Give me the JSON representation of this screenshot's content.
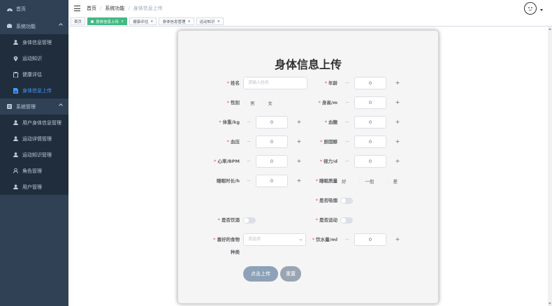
{
  "sidebar": {
    "items": [
      {
        "label": "首页",
        "icon": "dashboard-icon",
        "type": "top"
      },
      {
        "label": "系统功能",
        "icon": "function-icon",
        "type": "group"
      },
      {
        "label": "身体信息管理",
        "icon": "user-icon",
        "type": "sub"
      },
      {
        "label": "运动知识",
        "icon": "location-icon",
        "type": "sub"
      },
      {
        "label": "健康评估",
        "icon": "clipboard-icon",
        "type": "sub"
      },
      {
        "label": "身体信息上传",
        "icon": "document-icon",
        "type": "sub",
        "active": true
      },
      {
        "label": "系统管理",
        "icon": "settings-icon",
        "type": "group"
      },
      {
        "label": "用户身体信息管理",
        "icon": "user-icon",
        "type": "sub"
      },
      {
        "label": "运动详情管理",
        "icon": "user-icon",
        "type": "sub"
      },
      {
        "label": "运动知识管理",
        "icon": "user-icon",
        "type": "sub"
      },
      {
        "label": "角色管理",
        "icon": "person-icon",
        "type": "sub"
      },
      {
        "label": "用户管理",
        "icon": "user-icon",
        "type": "sub"
      }
    ]
  },
  "breadcrumb": [
    "首页",
    "系统功能",
    "身体信息上传"
  ],
  "tags": [
    {
      "label": "首页",
      "closable": false,
      "active": false
    },
    {
      "label": "身体信息上传",
      "closable": true,
      "active": true
    },
    {
      "label": "健康评估",
      "closable": true,
      "active": false
    },
    {
      "label": "身体信息管理",
      "closable": true,
      "active": false
    },
    {
      "label": "运动知识",
      "closable": true,
      "active": false
    }
  ],
  "tag_close": "×",
  "form": {
    "title": "身体信息上传",
    "required_mark": "*",
    "name": {
      "label": "姓名",
      "placeholder": "请输入姓名"
    },
    "age": {
      "label": "年龄",
      "value": "0"
    },
    "gender": {
      "label": "性别",
      "options": [
        "男",
        "女"
      ]
    },
    "height": {
      "label": "身高/m",
      "value": "0"
    },
    "weight": {
      "label": "体重/kg",
      "value": "0"
    },
    "blood_sugar": {
      "label": "血糖",
      "value": "0"
    },
    "blood_pressure": {
      "label": "血压",
      "value": "0"
    },
    "cholesterol": {
      "label": "胆固醇",
      "value": "0"
    },
    "heart_rate": {
      "label": "心率/BPM",
      "value": "0"
    },
    "vision": {
      "label": "视力/d",
      "value": "0"
    },
    "sleep_hours": {
      "label": "睡眠时长/h",
      "value": "0"
    },
    "sleep_quality": {
      "label": "睡眠质量",
      "options": [
        "好",
        "一般",
        "差"
      ]
    },
    "smoking": {
      "label": "是否吸烟"
    },
    "drinking": {
      "label": "是否饮酒"
    },
    "exercise": {
      "label": "是否运动"
    },
    "food": {
      "label_line1": "喜好的食物",
      "label_line2": "种类",
      "placeholder": "请选择"
    },
    "water": {
      "label": "饮水量/ml",
      "value": "0"
    },
    "submit_label": "点击上传",
    "reset_label": "重置"
  },
  "stepper": {
    "minus": "−",
    "plus": "+"
  },
  "colors": {
    "sidebar_bg": "#304156",
    "active_tag": "#42b983",
    "active_menu": "#409eff",
    "required": "#f56c6c"
  }
}
